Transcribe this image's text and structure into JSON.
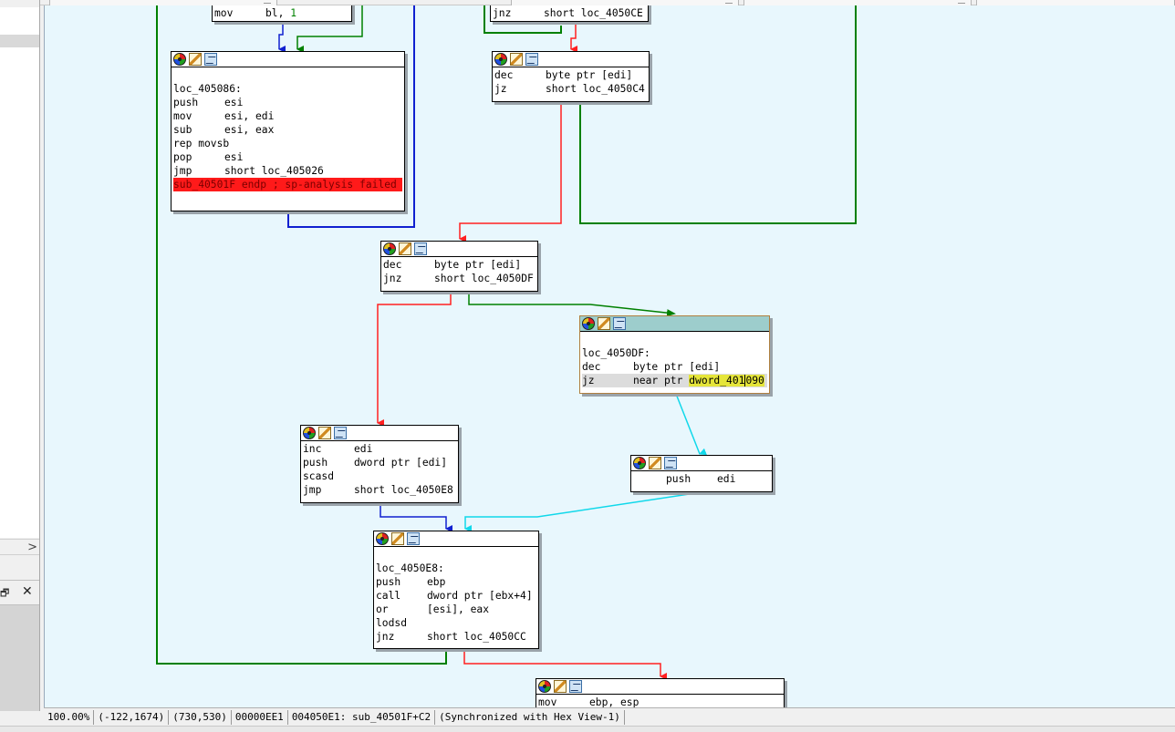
{
  "colors": {
    "graph_background": "#e8f7fd",
    "edge_true": "#008000",
    "edge_false": "#ff3030",
    "edge_unconditional": "#0000c0",
    "edge_jump_table": "#00e0f0",
    "error_line": "#ff1a1a",
    "highlight_operand": "#e5e53a",
    "selected_header": "#9dcdcc"
  },
  "header_icons": [
    "color-wheel-icon",
    "rename-pencil-icon",
    "group-nodes-icon"
  ],
  "nodes": {
    "n_top_left": {
      "lines": [
        {
          "mn": "mov",
          "op": "bl, ",
          "num": "1"
        }
      ]
    },
    "n_top_right": {
      "lines": [
        {
          "mn": "jnz",
          "op": "short loc_4050CE"
        }
      ]
    },
    "n_405086": {
      "lines": [
        {
          "label": "loc_405086:"
        },
        {
          "mn": "push",
          "op": "esi"
        },
        {
          "mn": "mov",
          "op": "esi, edi"
        },
        {
          "mn": "sub",
          "op": "esi, eax"
        },
        {
          "mn": "rep movsb",
          "op": ""
        },
        {
          "mn": "pop",
          "op": "esi"
        },
        {
          "mn": "jmp",
          "op": "short loc_405026"
        },
        {
          "error": "sub_40501F endp ; sp-analysis failed"
        }
      ]
    },
    "n_dec_jz": {
      "lines": [
        {
          "mn": "dec",
          "op": "byte ptr [edi]"
        },
        {
          "mn": "jz",
          "op": "short loc_4050C4"
        }
      ]
    },
    "n_dec_jnz": {
      "lines": [
        {
          "mn": "dec",
          "op": "byte ptr [edi]"
        },
        {
          "mn": "jnz",
          "op": "short loc_4050DF"
        }
      ]
    },
    "n_4050DF": {
      "lines": [
        {
          "label": "loc_4050DF:"
        },
        {
          "mn": "dec",
          "op": "byte ptr [edi]"
        },
        {
          "mn": "jz",
          "op_pre": "near ptr ",
          "op_hl_a": "dword_401",
          "op_hl_b": "090"
        }
      ]
    },
    "n_inc": {
      "lines": [
        {
          "mn": "inc",
          "op": "edi"
        },
        {
          "mn": "push",
          "op": "dword ptr [edi]"
        },
        {
          "mn": "scasd",
          "op": ""
        },
        {
          "mn": "jmp",
          "op": "short loc_4050E8"
        }
      ]
    },
    "n_push_edi": {
      "lines": [
        {
          "mn": "push",
          "op": "edi"
        }
      ]
    },
    "n_4050E8": {
      "lines": [
        {
          "label": "loc_4050E8:"
        },
        {
          "mn": "push",
          "op": "ebp"
        },
        {
          "mn": "call",
          "op": "dword ptr [ebx+4]"
        },
        {
          "mn": "or",
          "op": "[esi], eax"
        },
        {
          "mn": "lodsd",
          "op": ""
        },
        {
          "mn": "jnz",
          "op": "short loc_4050CC"
        }
      ]
    },
    "n_bottom": {
      "lines": [
        {
          "mn": "mov",
          "op": "ebp, esp"
        }
      ]
    }
  },
  "statusbar": {
    "zoom": "100.00%",
    "mouse_coords": "(-122,1674)",
    "cursor_coords": "(730,530)",
    "file_offset": "00000EE1",
    "address": "004050E1: sub_40501F+C2",
    "sync": "(Synchronized with Hex View-1)"
  },
  "left_panel": {
    "scroll_right_glyph": ">",
    "float_glyph": "🗗",
    "close_glyph": "✕"
  }
}
